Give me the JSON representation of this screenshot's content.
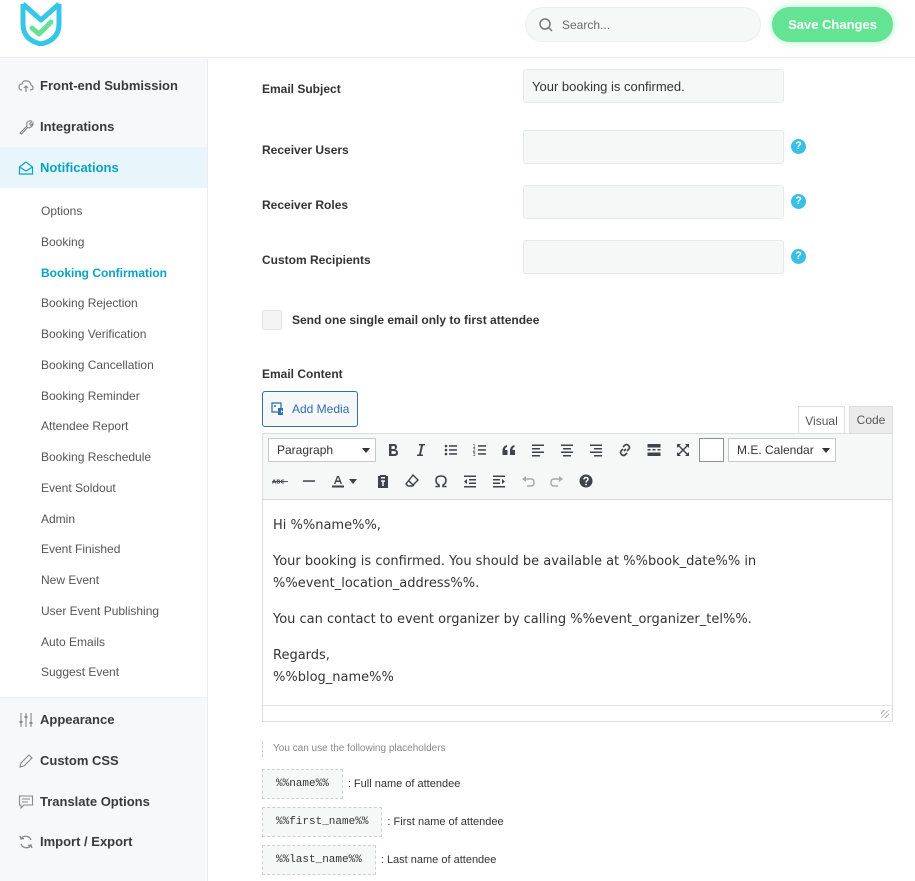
{
  "header": {
    "search_placeholder": "Search...",
    "save_label": "Save Changes"
  },
  "colors": {
    "accent": "#07a3c5",
    "save": "#64e394",
    "help": "#37c0e3",
    "link": "#2f6fb5"
  },
  "sidebar": {
    "top_items": [
      {
        "label": "Front-end Submission",
        "icon": "cloud-upload-icon"
      },
      {
        "label": "Integrations",
        "icon": "wrench-icon"
      },
      {
        "label": "Notifications",
        "icon": "envelope-open-icon",
        "active": true
      }
    ],
    "sub_items": [
      "Options",
      "Booking",
      "Booking Confirmation",
      "Booking Rejection",
      "Booking Verification",
      "Booking Cancellation",
      "Booking Reminder",
      "Attendee Report",
      "Booking Reschedule",
      "Event Soldout",
      "Admin",
      "Event Finished",
      "New Event",
      "User Event Publishing",
      "Auto Emails",
      "Suggest Event"
    ],
    "active_sub": "Booking Confirmation",
    "bottom_items": [
      {
        "label": "Appearance",
        "icon": "sliders-icon"
      },
      {
        "label": "Custom CSS",
        "icon": "pencil-icon"
      },
      {
        "label": "Translate Options",
        "icon": "chat-icon"
      },
      {
        "label": "Import / Export",
        "icon": "refresh-icon"
      }
    ]
  },
  "form": {
    "email_subject_label": "Email Subject",
    "email_subject_value": "Your booking is confirmed.",
    "receiver_users_label": "Receiver Users",
    "receiver_roles_label": "Receiver Roles",
    "custom_recipients_label": "Custom Recipients",
    "help_glyph": "?",
    "single_email_label": "Send one single email only to first attendee",
    "email_content_label": "Email Content"
  },
  "editor": {
    "add_media_label": "Add Media",
    "tab_visual": "Visual",
    "tab_code": "Code",
    "format_select": "Paragraph",
    "shortcode_select": "M.E. Calendar",
    "paragraphs": [
      "Hi %%name%%,",
      "Your booking is confirmed. You should be available at %%book_date%% in %%event_location_address%%.",
      "You can contact to event organizer by calling %%event_organizer_tel%%.",
      "Regards,",
      "%%blog_name%%"
    ]
  },
  "placeholders": {
    "hint": "You can use the following placeholders",
    "items": [
      {
        "code": "%%name%%",
        "desc": ": Full name of attendee"
      },
      {
        "code": "%%first_name%%",
        "desc": ": First name of attendee"
      },
      {
        "code": "%%last_name%%",
        "desc": ": Last name of attendee"
      }
    ]
  }
}
